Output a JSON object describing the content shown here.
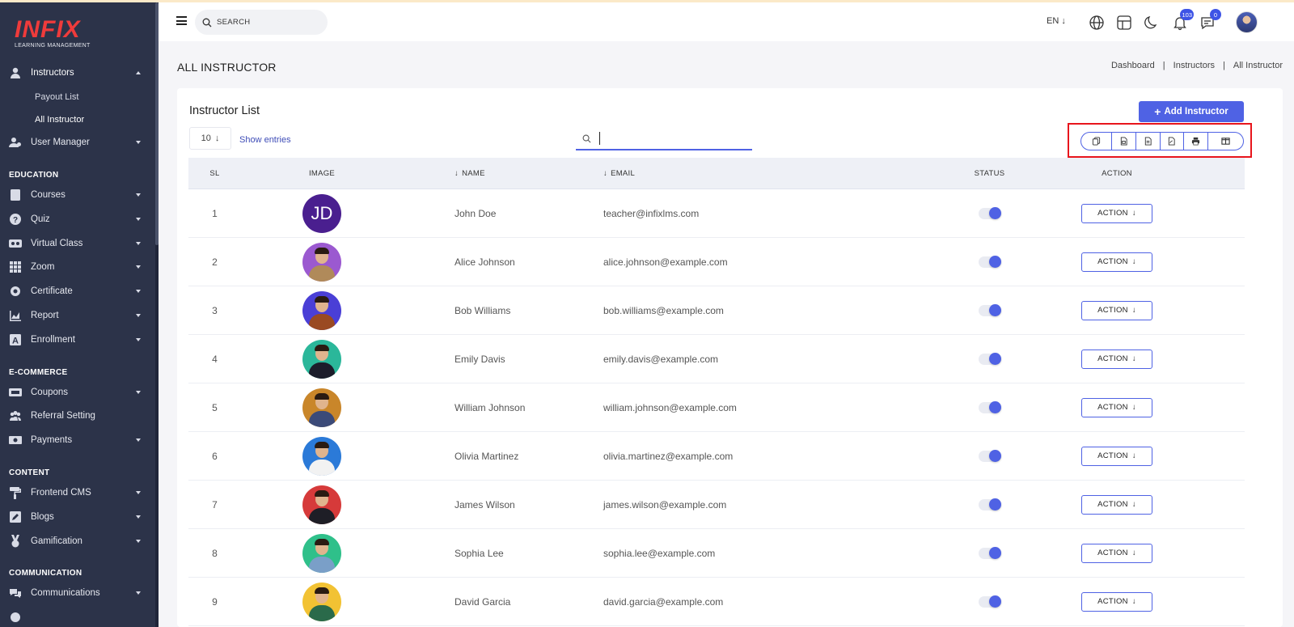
{
  "brand": {
    "logo_text": "INFIX",
    "tagline": "LEARNING MANAGEMENT"
  },
  "header": {
    "search_placeholder": "SEARCH",
    "language": "EN",
    "notifications_count": "103",
    "messages_count": "0"
  },
  "sidebar": {
    "instructors": {
      "label": "Instructors",
      "icon": "instructor-icon"
    },
    "instructor_sub": [
      "Payout List",
      "All Instructor"
    ],
    "user_manager": {
      "label": "User Manager",
      "icon": "user-manager-icon"
    },
    "sections": {
      "education": "EDUCATION",
      "ecommerce": "E-COMMERCE",
      "content": "CONTENT",
      "communication": "COMMUNICATION"
    },
    "education_items": [
      "Courses",
      "Quiz",
      "Virtual Class",
      "Zoom",
      "Certificate",
      "Report",
      "Enrollment"
    ],
    "ecommerce_items": [
      "Coupons",
      "Referral Setting",
      "Payments"
    ],
    "content_items": [
      "Frontend CMS",
      "Blogs",
      "Gamification"
    ],
    "communication_items": [
      "Communications"
    ]
  },
  "page": {
    "title": "ALL INSTRUCTOR",
    "breadcrumb": [
      "Dashboard",
      "Instructors",
      "All Instructor"
    ]
  },
  "card": {
    "title": "Instructor List",
    "add_button": "Add Instructor",
    "entries_value": "10",
    "show_entries": "Show entries",
    "export_buttons": [
      "copy-icon",
      "csv-icon",
      "excel-icon",
      "pdf-icon",
      "print-icon",
      "columns-icon"
    ]
  },
  "table": {
    "headers": {
      "sl": "SL",
      "image": "IMAGE",
      "name": "NAME",
      "email": "EMAIL",
      "status": "STATUS",
      "action": "ACTION"
    },
    "action_label": "ACTION",
    "rows": [
      {
        "sl": "1",
        "initials": "JD",
        "name": "John Doe",
        "email": "teacher@infixlms.com",
        "bg": "#4a1f8f"
      },
      {
        "sl": "2",
        "name": "Alice Johnson",
        "email": "alice.johnson@example.com",
        "bg": "#9b59d0",
        "shirt": "#b08a5a"
      },
      {
        "sl": "3",
        "name": "Bob Williams",
        "email": "bob.williams@example.com",
        "bg": "#4a3fd6",
        "shirt": "#9a4a22"
      },
      {
        "sl": "4",
        "name": "Emily Davis",
        "email": "emily.davis@example.com",
        "bg": "#2bb79a",
        "shirt": "#1c1c2a"
      },
      {
        "sl": "5",
        "name": "William Johnson",
        "email": "william.johnson@example.com",
        "bg": "#c9862a",
        "shirt": "#3b4a78"
      },
      {
        "sl": "6",
        "name": "Olivia Martinez",
        "email": "olivia.martinez@example.com",
        "bg": "#2b7ad8",
        "shirt": "#f2f2f2"
      },
      {
        "sl": "7",
        "name": "James Wilson",
        "email": "james.wilson@example.com",
        "bg": "#d63a3a",
        "shirt": "#1e1e26"
      },
      {
        "sl": "8",
        "name": "Sophia Lee",
        "email": "sophia.lee@example.com",
        "bg": "#2fc08a",
        "shirt": "#7a9fc8"
      },
      {
        "sl": "9",
        "name": "David Garcia",
        "email": "david.garcia@example.com",
        "bg": "#f2c233",
        "shirt": "#2a6a4a"
      }
    ]
  }
}
